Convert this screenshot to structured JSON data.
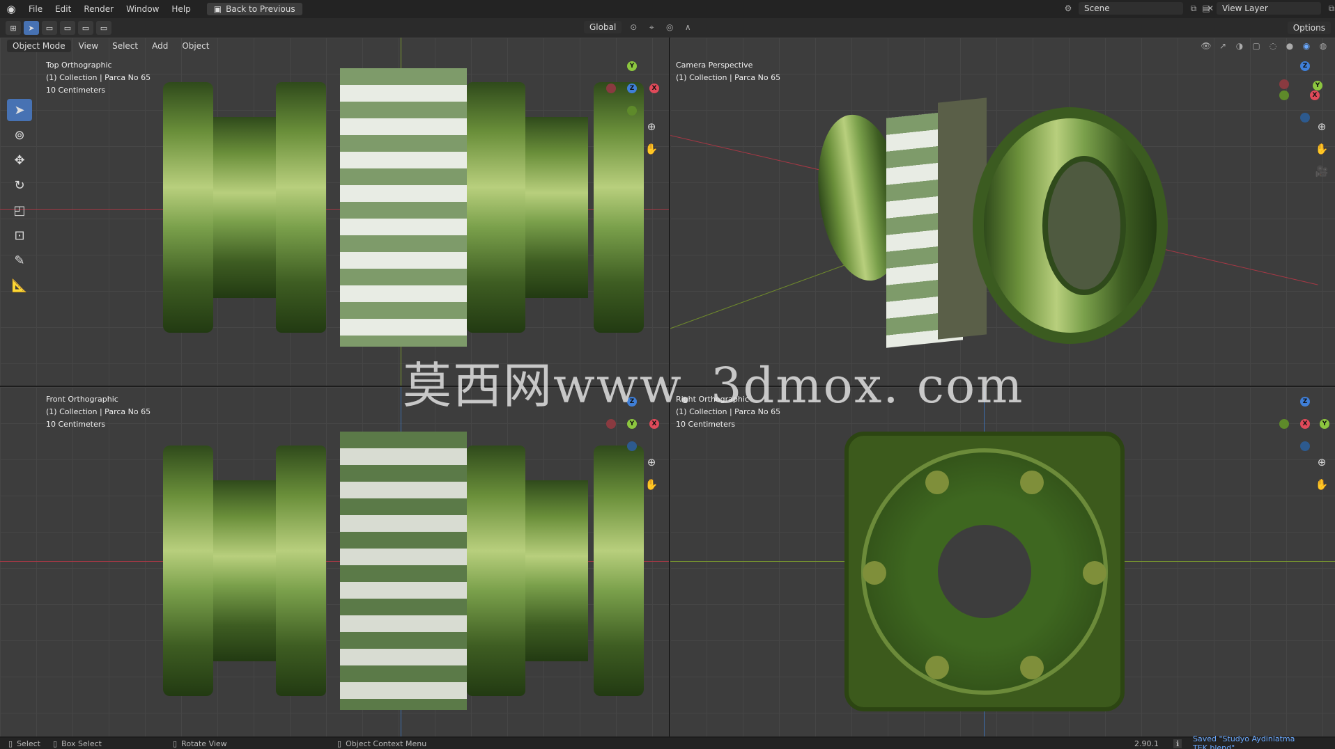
{
  "topbar": {
    "menu": [
      "File",
      "Edit",
      "Render",
      "Window",
      "Help"
    ],
    "back_button": "Back to Previous",
    "scene_label": "Scene",
    "view_layer_label": "View Layer"
  },
  "toolbar": {
    "orientation": "Global",
    "options": "Options"
  },
  "viewport_header": {
    "mode": "Object Mode",
    "menu": [
      "View",
      "Select",
      "Add",
      "Object"
    ]
  },
  "viewports": {
    "top_left": {
      "title": "Top Orthographic",
      "collection": "(1) Collection | Parca No 65",
      "scale": "10 Centimeters"
    },
    "top_right": {
      "title": "Camera Perspective",
      "collection": "(1) Collection | Parca No 65"
    },
    "bottom_left": {
      "title": "Front Orthographic",
      "collection": "(1) Collection | Parca No 65",
      "scale": "10 Centimeters"
    },
    "bottom_right": {
      "title": "Right Orthographic",
      "collection": "(1) Collection | Parca No 65",
      "scale": "10 Centimeters"
    }
  },
  "watermark": "莫西网www. 3dmox. com",
  "statusbar": {
    "select": "Select",
    "box_select": "Box Select",
    "rotate_view": "Rotate View",
    "context_menu": "Object Context Menu",
    "version": "2.90.1",
    "message": "Saved \"Studyo Aydinlatma TEK.blend\""
  },
  "colors": {
    "x_axis": "#e04a5a",
    "y_axis": "#8cc63f",
    "z_axis": "#3f7fd8",
    "accent": "#4772b3",
    "status_message": "#6aa9ff"
  },
  "icons": [
    "blender-logo-icon",
    "select-cursor-icon",
    "cursor-icon",
    "move-icon",
    "rotate-icon",
    "scale-icon",
    "transform-icon",
    "annotate-icon",
    "measure-icon",
    "zoom-icon",
    "hand-icon",
    "camera-icon"
  ]
}
